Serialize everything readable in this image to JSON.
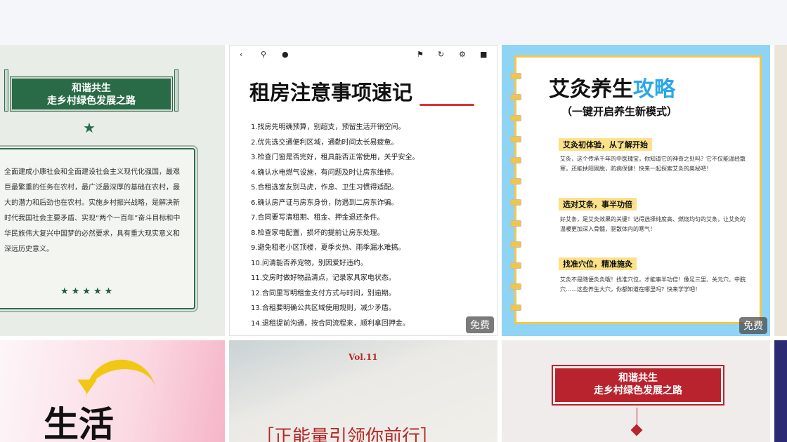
{
  "cards": {
    "card1": {
      "banner_line1": "和谐共生",
      "banner_line2": "走乡村绿色发展之路",
      "star": "★",
      "paragraph": "全面建成小康社会和全面建设社会主义现代化强国，最艰巨最繁重的任务在农村，最广泛最深厚的基础在农村，最大的潜力和后劲也在农村。实施乡村振兴战略，是解决新时代我国社会主要矛盾、实现“两个一百年”奋斗目标和中华民族伟大复兴中国梦的必然要求，具有重大现实意义和深远历史意义。",
      "stars": "★★★★★"
    },
    "card2": {
      "title": "租房注意事项速记",
      "tips": [
        "1.找房先明确预算，别超支，预留生活开销空间。",
        "2.优先选交通便利区域，通勤时间太长易疲惫。",
        "3.检查门窗是否完好，租具能否正常使用，关乎安全。",
        "4.确认水电燃气设施，有问题及时让房东维修。",
        "5.合租选室友别马虎，作息、卫生习惯得适配。",
        "6.确认房产证与房东身份，防遇到二房东诈骗。",
        "7.合同要写清租期、租金、押金退还条件。",
        "8.检查家电配置，损坏的提前让房东处理。",
        "9.避免租老小区顶楼，夏季炎热、雨季漏水难搞。",
        "10.问清能否养宠物，别因爱好违约。",
        "11.交房时做好物品清点，记录家具家电状态。",
        "12.合同里写明租金支付方式与时间，别逾期。",
        "13.合租要明确公共区域使用规则，减少矛盾。",
        "14.退租提前沟通，按合同流程来，顺利拿回押金。"
      ],
      "badge": "免费"
    },
    "card3": {
      "title_main": "艾灸养生",
      "title_accent": "攻略",
      "subtitle": "（一键开启养生新模式）",
      "sections": [
        {
          "heading": "艾灸初体验，从了解开始",
          "body": "艾灸，这个传承千年的中医瑰宝，你知道它的神奇之处吗？它不仅能温经散寒，还能扶阳固脱，防病保健！快来一起探索艾灸的奥秘吧！"
        },
        {
          "heading": "选对艾条，事半功倍",
          "body": "好艾条，是艾灸效果的关键！记得选择纯度高、燃烧均匀的艾条，让艾灸的温暖更加深入骨髓，驱散体内的寒气！"
        },
        {
          "heading": "找准穴位，精准施灸",
          "body": "艾灸不是随便灸灸哦！找准穴位，才能事半功倍！像足三里、关元穴、中脘穴……这些养生大穴，你都知道在哪里吗？快来学学吧！"
        }
      ],
      "badge": "免费"
    },
    "card5": {
      "text": "生活"
    },
    "card6": {
      "vol": "Vol.11",
      "headline": "［正能量引领你前行］"
    },
    "card7": {
      "banner_line1": "和谐共生",
      "banner_line2": "走乡村绿色发展之路"
    }
  },
  "toolbar_icons": [
    "chevron-left-icon",
    "search-icon",
    "bell-icon",
    "flag-icon",
    "refresh-icon",
    "gear-icon",
    "lock-icon"
  ],
  "colors": {
    "green": "#2a6b47",
    "red": "#b8232e",
    "sky": "#8fd4f4",
    "yellow": "#f3c74a",
    "accent_blue": "#2aa7e8"
  }
}
